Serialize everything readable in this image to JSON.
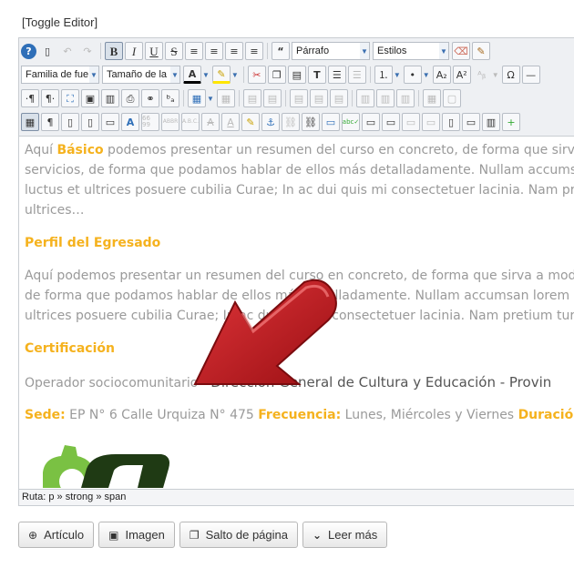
{
  "toggle_editor": "[Toggle Editor]",
  "toolbar": {
    "format_select": "Párrafo",
    "styles_select": "Estilos",
    "font_family_select": "Familia de fue",
    "font_size_select": "Tamaño de la"
  },
  "content": {
    "p1": {
      "pre": "Aquí ",
      "highlight": "Básico",
      "post": " podemos presentar un resumen del curso en concreto, de forma que sirva",
      "line2": "servicios, de forma que podamos hablar de ellos más detalladamente. Nullam accumsa",
      "line3": "luctus et ultrices posuere cubilia Curae; In ac dui quis mi consectetuer lacinia. Nam pre",
      "line4": "ultrices…"
    },
    "heading_egresado": "Perfil del Egresado",
    "p2": {
      "line1": "Aquí podemos presentar un resumen del curso en concreto, de forma que sirva a mode",
      "line2": "de forma que podamos hablar de ellos más detalladamente. Nullam accumsan lorem in",
      "line3": "ultrices posuere cubilia Curae; In ac dui quis mi consectetuer lacinia. Nam pretium turp"
    },
    "heading_certificacion": "Certificación",
    "cert": {
      "pre": "Operador sociocomunitario - ",
      "dark": "Dirección General de Cultura y Educación - Provin"
    },
    "info": {
      "sede_label": "Sede:",
      "sede_value": " EP N° 6  Calle Urquiza N° 475 ",
      "frecuencia_label": "Frecuencia:",
      "frecuencia_value": " Lunes, Miércoles y Viernes  ",
      "duracion_label": "Duració"
    }
  },
  "statusbar": {
    "path": "Ruta:  p » strong » span"
  },
  "buttons": {
    "articulo": "Artículo",
    "imagen": "Imagen",
    "salto": "Salto de página",
    "leer_mas": "Leer más"
  },
  "colors": {
    "accent": "#f5b21e",
    "arrow_red": "#c3161c",
    "logo_green": "#7ac143"
  }
}
